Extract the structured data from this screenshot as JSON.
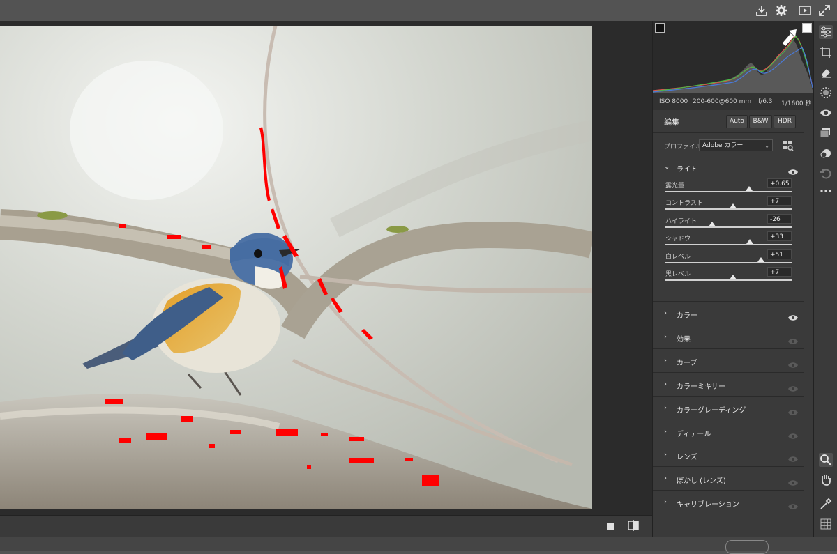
{
  "camera": {
    "iso": "ISO 8000",
    "lens": "200-600@600 mm",
    "aperture": "f/6.3",
    "shutter": "1/1600 秒"
  },
  "edit": {
    "title": "編集",
    "auto": "Auto",
    "bw": "B&W",
    "hdr": "HDR",
    "profile_label": "プロファイル",
    "profile_value": "Adobe カラー"
  },
  "light": {
    "label": "ライト",
    "sliders": [
      {
        "label": "露光量",
        "value": "+0.65",
        "level": 0.66
      },
      {
        "label": "コントラスト",
        "value": "+7",
        "level": 0.535
      },
      {
        "label": "ハイライト",
        "value": "-26",
        "level": 0.37
      },
      {
        "label": "シャドウ",
        "value": "+33",
        "level": 0.665
      },
      {
        "label": "白レベル",
        "value": "+51",
        "level": 0.755
      },
      {
        "label": "黒レベル",
        "value": "+7",
        "level": 0.535
      }
    ]
  },
  "sections": [
    {
      "label": "カラー",
      "eye": "eye-icon",
      "eye_on": true
    },
    {
      "label": "効果",
      "eye": "eye-icon",
      "eye_on": false
    },
    {
      "label": "カーブ",
      "eye": "eye-icon",
      "eye_on": false
    },
    {
      "label": "カラーミキサー",
      "eye": "eye-icon",
      "eye_on": false
    },
    {
      "label": "カラーグレーディング",
      "eye": "eye-icon",
      "eye_on": false
    },
    {
      "label": "ディテール",
      "eye": "eye-icon",
      "eye_on": false
    },
    {
      "label": "レンズ",
      "eye": "eye-icon",
      "eye_on": false
    },
    {
      "label": "ぼかし (レンズ)",
      "eye": "eye-icon",
      "eye_on": false
    },
    {
      "label": "キャリブレーション",
      "eye": "eye-icon",
      "eye_on": false
    }
  ],
  "icons": {
    "top": [
      "save-icon",
      "gear-icon",
      "fullscreen-preview-icon",
      "expand-icon"
    ],
    "tools": [
      "edit-sliders-icon",
      "crop-icon",
      "eraser-icon",
      "masking-icon",
      "redeye-icon",
      "presets-icon",
      "snapshots-icon",
      "history-icon",
      "more-icon",
      "zoom-icon",
      "hand-icon",
      "color-sampler-icon",
      "grid-icon"
    ],
    "bottom": [
      "single-view-icon",
      "before-after-icon"
    ]
  },
  "colors": {
    "accent": "#e8e8e8",
    "clipping": "#ff0000",
    "panel": "#3a3a3a",
    "chrome": "#535353"
  }
}
